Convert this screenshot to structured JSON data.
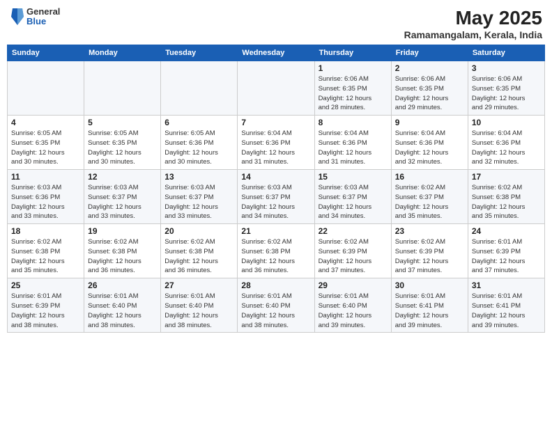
{
  "header": {
    "logo_general": "General",
    "logo_blue": "Blue",
    "month": "May 2025",
    "location": "Ramamangalam, Kerala, India"
  },
  "weekdays": [
    "Sunday",
    "Monday",
    "Tuesday",
    "Wednesday",
    "Thursday",
    "Friday",
    "Saturday"
  ],
  "weeks": [
    [
      {
        "day": "",
        "info": ""
      },
      {
        "day": "",
        "info": ""
      },
      {
        "day": "",
        "info": ""
      },
      {
        "day": "",
        "info": ""
      },
      {
        "day": "1",
        "info": "Sunrise: 6:06 AM\nSunset: 6:35 PM\nDaylight: 12 hours\nand 28 minutes."
      },
      {
        "day": "2",
        "info": "Sunrise: 6:06 AM\nSunset: 6:35 PM\nDaylight: 12 hours\nand 29 minutes."
      },
      {
        "day": "3",
        "info": "Sunrise: 6:06 AM\nSunset: 6:35 PM\nDaylight: 12 hours\nand 29 minutes."
      }
    ],
    [
      {
        "day": "4",
        "info": "Sunrise: 6:05 AM\nSunset: 6:35 PM\nDaylight: 12 hours\nand 30 minutes."
      },
      {
        "day": "5",
        "info": "Sunrise: 6:05 AM\nSunset: 6:35 PM\nDaylight: 12 hours\nand 30 minutes."
      },
      {
        "day": "6",
        "info": "Sunrise: 6:05 AM\nSunset: 6:36 PM\nDaylight: 12 hours\nand 30 minutes."
      },
      {
        "day": "7",
        "info": "Sunrise: 6:04 AM\nSunset: 6:36 PM\nDaylight: 12 hours\nand 31 minutes."
      },
      {
        "day": "8",
        "info": "Sunrise: 6:04 AM\nSunset: 6:36 PM\nDaylight: 12 hours\nand 31 minutes."
      },
      {
        "day": "9",
        "info": "Sunrise: 6:04 AM\nSunset: 6:36 PM\nDaylight: 12 hours\nand 32 minutes."
      },
      {
        "day": "10",
        "info": "Sunrise: 6:04 AM\nSunset: 6:36 PM\nDaylight: 12 hours\nand 32 minutes."
      }
    ],
    [
      {
        "day": "11",
        "info": "Sunrise: 6:03 AM\nSunset: 6:36 PM\nDaylight: 12 hours\nand 33 minutes."
      },
      {
        "day": "12",
        "info": "Sunrise: 6:03 AM\nSunset: 6:37 PM\nDaylight: 12 hours\nand 33 minutes."
      },
      {
        "day": "13",
        "info": "Sunrise: 6:03 AM\nSunset: 6:37 PM\nDaylight: 12 hours\nand 33 minutes."
      },
      {
        "day": "14",
        "info": "Sunrise: 6:03 AM\nSunset: 6:37 PM\nDaylight: 12 hours\nand 34 minutes."
      },
      {
        "day": "15",
        "info": "Sunrise: 6:03 AM\nSunset: 6:37 PM\nDaylight: 12 hours\nand 34 minutes."
      },
      {
        "day": "16",
        "info": "Sunrise: 6:02 AM\nSunset: 6:37 PM\nDaylight: 12 hours\nand 35 minutes."
      },
      {
        "day": "17",
        "info": "Sunrise: 6:02 AM\nSunset: 6:38 PM\nDaylight: 12 hours\nand 35 minutes."
      }
    ],
    [
      {
        "day": "18",
        "info": "Sunrise: 6:02 AM\nSunset: 6:38 PM\nDaylight: 12 hours\nand 35 minutes."
      },
      {
        "day": "19",
        "info": "Sunrise: 6:02 AM\nSunset: 6:38 PM\nDaylight: 12 hours\nand 36 minutes."
      },
      {
        "day": "20",
        "info": "Sunrise: 6:02 AM\nSunset: 6:38 PM\nDaylight: 12 hours\nand 36 minutes."
      },
      {
        "day": "21",
        "info": "Sunrise: 6:02 AM\nSunset: 6:38 PM\nDaylight: 12 hours\nand 36 minutes."
      },
      {
        "day": "22",
        "info": "Sunrise: 6:02 AM\nSunset: 6:39 PM\nDaylight: 12 hours\nand 37 minutes."
      },
      {
        "day": "23",
        "info": "Sunrise: 6:02 AM\nSunset: 6:39 PM\nDaylight: 12 hours\nand 37 minutes."
      },
      {
        "day": "24",
        "info": "Sunrise: 6:01 AM\nSunset: 6:39 PM\nDaylight: 12 hours\nand 37 minutes."
      }
    ],
    [
      {
        "day": "25",
        "info": "Sunrise: 6:01 AM\nSunset: 6:39 PM\nDaylight: 12 hours\nand 38 minutes."
      },
      {
        "day": "26",
        "info": "Sunrise: 6:01 AM\nSunset: 6:40 PM\nDaylight: 12 hours\nand 38 minutes."
      },
      {
        "day": "27",
        "info": "Sunrise: 6:01 AM\nSunset: 6:40 PM\nDaylight: 12 hours\nand 38 minutes."
      },
      {
        "day": "28",
        "info": "Sunrise: 6:01 AM\nSunset: 6:40 PM\nDaylight: 12 hours\nand 38 minutes."
      },
      {
        "day": "29",
        "info": "Sunrise: 6:01 AM\nSunset: 6:40 PM\nDaylight: 12 hours\nand 39 minutes."
      },
      {
        "day": "30",
        "info": "Sunrise: 6:01 AM\nSunset: 6:41 PM\nDaylight: 12 hours\nand 39 minutes."
      },
      {
        "day": "31",
        "info": "Sunrise: 6:01 AM\nSunset: 6:41 PM\nDaylight: 12 hours\nand 39 minutes."
      }
    ]
  ]
}
